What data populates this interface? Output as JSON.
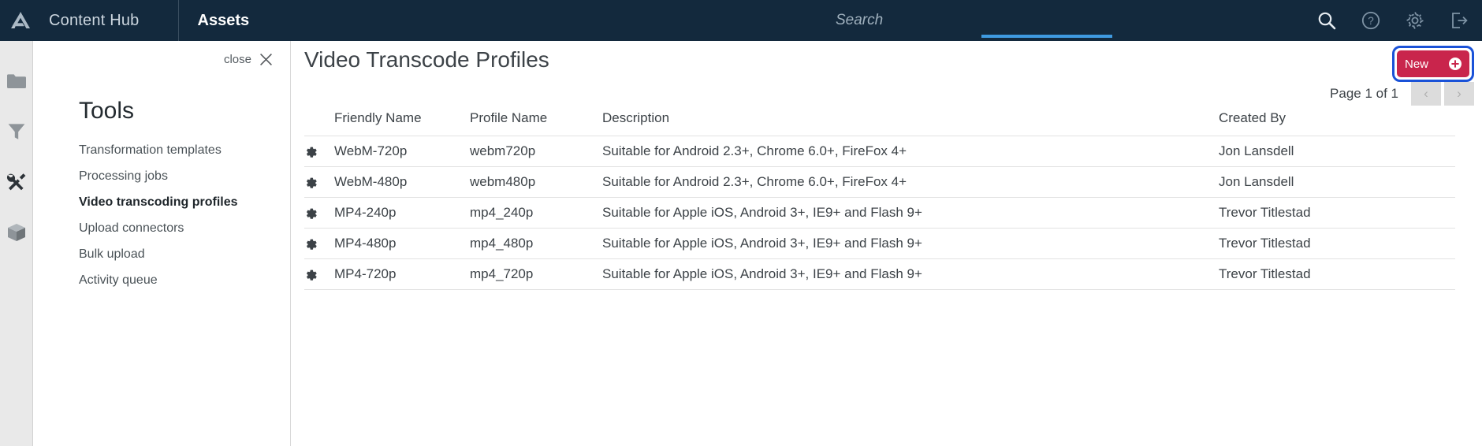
{
  "topbar": {
    "logo_icon": "delta-logo-icon",
    "brand": "Content Hub",
    "section": "Assets",
    "search": {
      "value": "",
      "placeholder": "Search"
    },
    "icons": [
      {
        "name": "search-icon",
        "label": "Search"
      },
      {
        "name": "help-icon",
        "label": "Help"
      },
      {
        "name": "gear-icon",
        "label": "Settings"
      },
      {
        "name": "logout-icon",
        "label": "Sign out"
      }
    ],
    "accent_underline_color": "#3f9ae0",
    "background_color": "#13293d"
  },
  "rail": {
    "items": [
      {
        "name": "folder-icon",
        "label": "Browse",
        "active": false
      },
      {
        "name": "filter-icon",
        "label": "Filters",
        "active": false
      },
      {
        "name": "tools-icon",
        "label": "Tools",
        "active": true
      },
      {
        "name": "package-icon",
        "label": "Packages",
        "active": false
      }
    ]
  },
  "tools_panel": {
    "close_label": "close",
    "close_icon": "close-icon",
    "heading": "Tools",
    "items": [
      {
        "label": "Transformation templates",
        "active": false
      },
      {
        "label": "Processing jobs",
        "active": false
      },
      {
        "label": "Video transcoding profiles",
        "active": true
      },
      {
        "label": "Upload connectors",
        "active": false
      },
      {
        "label": "Bulk upload",
        "active": false
      },
      {
        "label": "Activity queue",
        "active": false
      }
    ]
  },
  "main": {
    "page_title": "Video Transcode Profiles",
    "new_button": {
      "label": "New",
      "icon": "plus-circle-icon",
      "color": "#c9254c",
      "focus_ring_color": "#1a52d8"
    },
    "pagination": {
      "text": "Page 1 of 1",
      "prev_label": "‹",
      "next_label": "›"
    },
    "table": {
      "row_action_icon": "gear-icon",
      "columns": [
        "",
        "Friendly Name",
        "Profile Name",
        "Description",
        "Created By"
      ],
      "rows": [
        {
          "friendly_name": "WebM-720p",
          "profile_name": "webm720p",
          "description": "Suitable for Android 2.3+, Chrome 6.0+, FireFox 4+",
          "created_by": "Jon Lansdell"
        },
        {
          "friendly_name": "WebM-480p",
          "profile_name": "webm480p",
          "description": "Suitable for Android 2.3+, Chrome 6.0+, FireFox 4+",
          "created_by": "Jon Lansdell"
        },
        {
          "friendly_name": "MP4-240p",
          "profile_name": "mp4_240p",
          "description": "Suitable for Apple iOS, Android 3+, IE9+ and Flash 9+",
          "created_by": "Trevor Titlestad"
        },
        {
          "friendly_name": "MP4-480p",
          "profile_name": "mp4_480p",
          "description": "Suitable for Apple iOS, Android 3+, IE9+ and Flash 9+",
          "created_by": "Trevor Titlestad"
        },
        {
          "friendly_name": "MP4-720p",
          "profile_name": "mp4_720p",
          "description": "Suitable for Apple iOS, Android 3+, IE9+ and Flash 9+",
          "created_by": "Trevor Titlestad"
        }
      ]
    }
  }
}
